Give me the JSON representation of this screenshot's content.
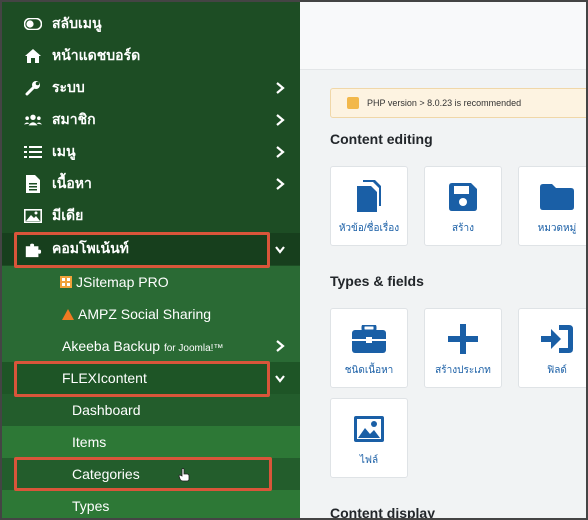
{
  "sidebar": {
    "toggle_menu": "สลับเมนู",
    "dashboard": "หน้าแดชบอร์ด",
    "system": "ระบบ",
    "users": "สมาชิก",
    "menus": "เมนู",
    "content": "เนื้อหา",
    "media": "มีเดีย",
    "components": "คอมโพเน้นท์",
    "jsitemap": "JSitemap PRO",
    "ampz": "AMPZ Social Sharing",
    "akeeba": "Akeeba Backup",
    "akeeba_suffix": "for Joomla!™",
    "flexicontent": "FLEXIcontent",
    "fc_dashboard": "Dashboard",
    "fc_items": "Items",
    "fc_categories": "Categories",
    "fc_types": "Types"
  },
  "main": {
    "notice": "PHP version > 8.0.23 is recommended",
    "content_editing_title": "Content editing",
    "types_fields_title": "Types & fields",
    "content_display_title": "Content display",
    "tiles_editing": [
      "หัวข้อ/ชื่อเรื่อง",
      "สร้าง",
      "หมวดหมู่"
    ],
    "tiles_types": [
      "ชนิดเนื้อหา",
      "สร้างประเภท",
      "ฟิลด์"
    ],
    "tiles_files": [
      "ไฟล์"
    ]
  },
  "colors": {
    "sidebar_bg": "#1d4d24",
    "highlight_border": "#d9553a",
    "tile_icon": "#1a5fa6"
  }
}
